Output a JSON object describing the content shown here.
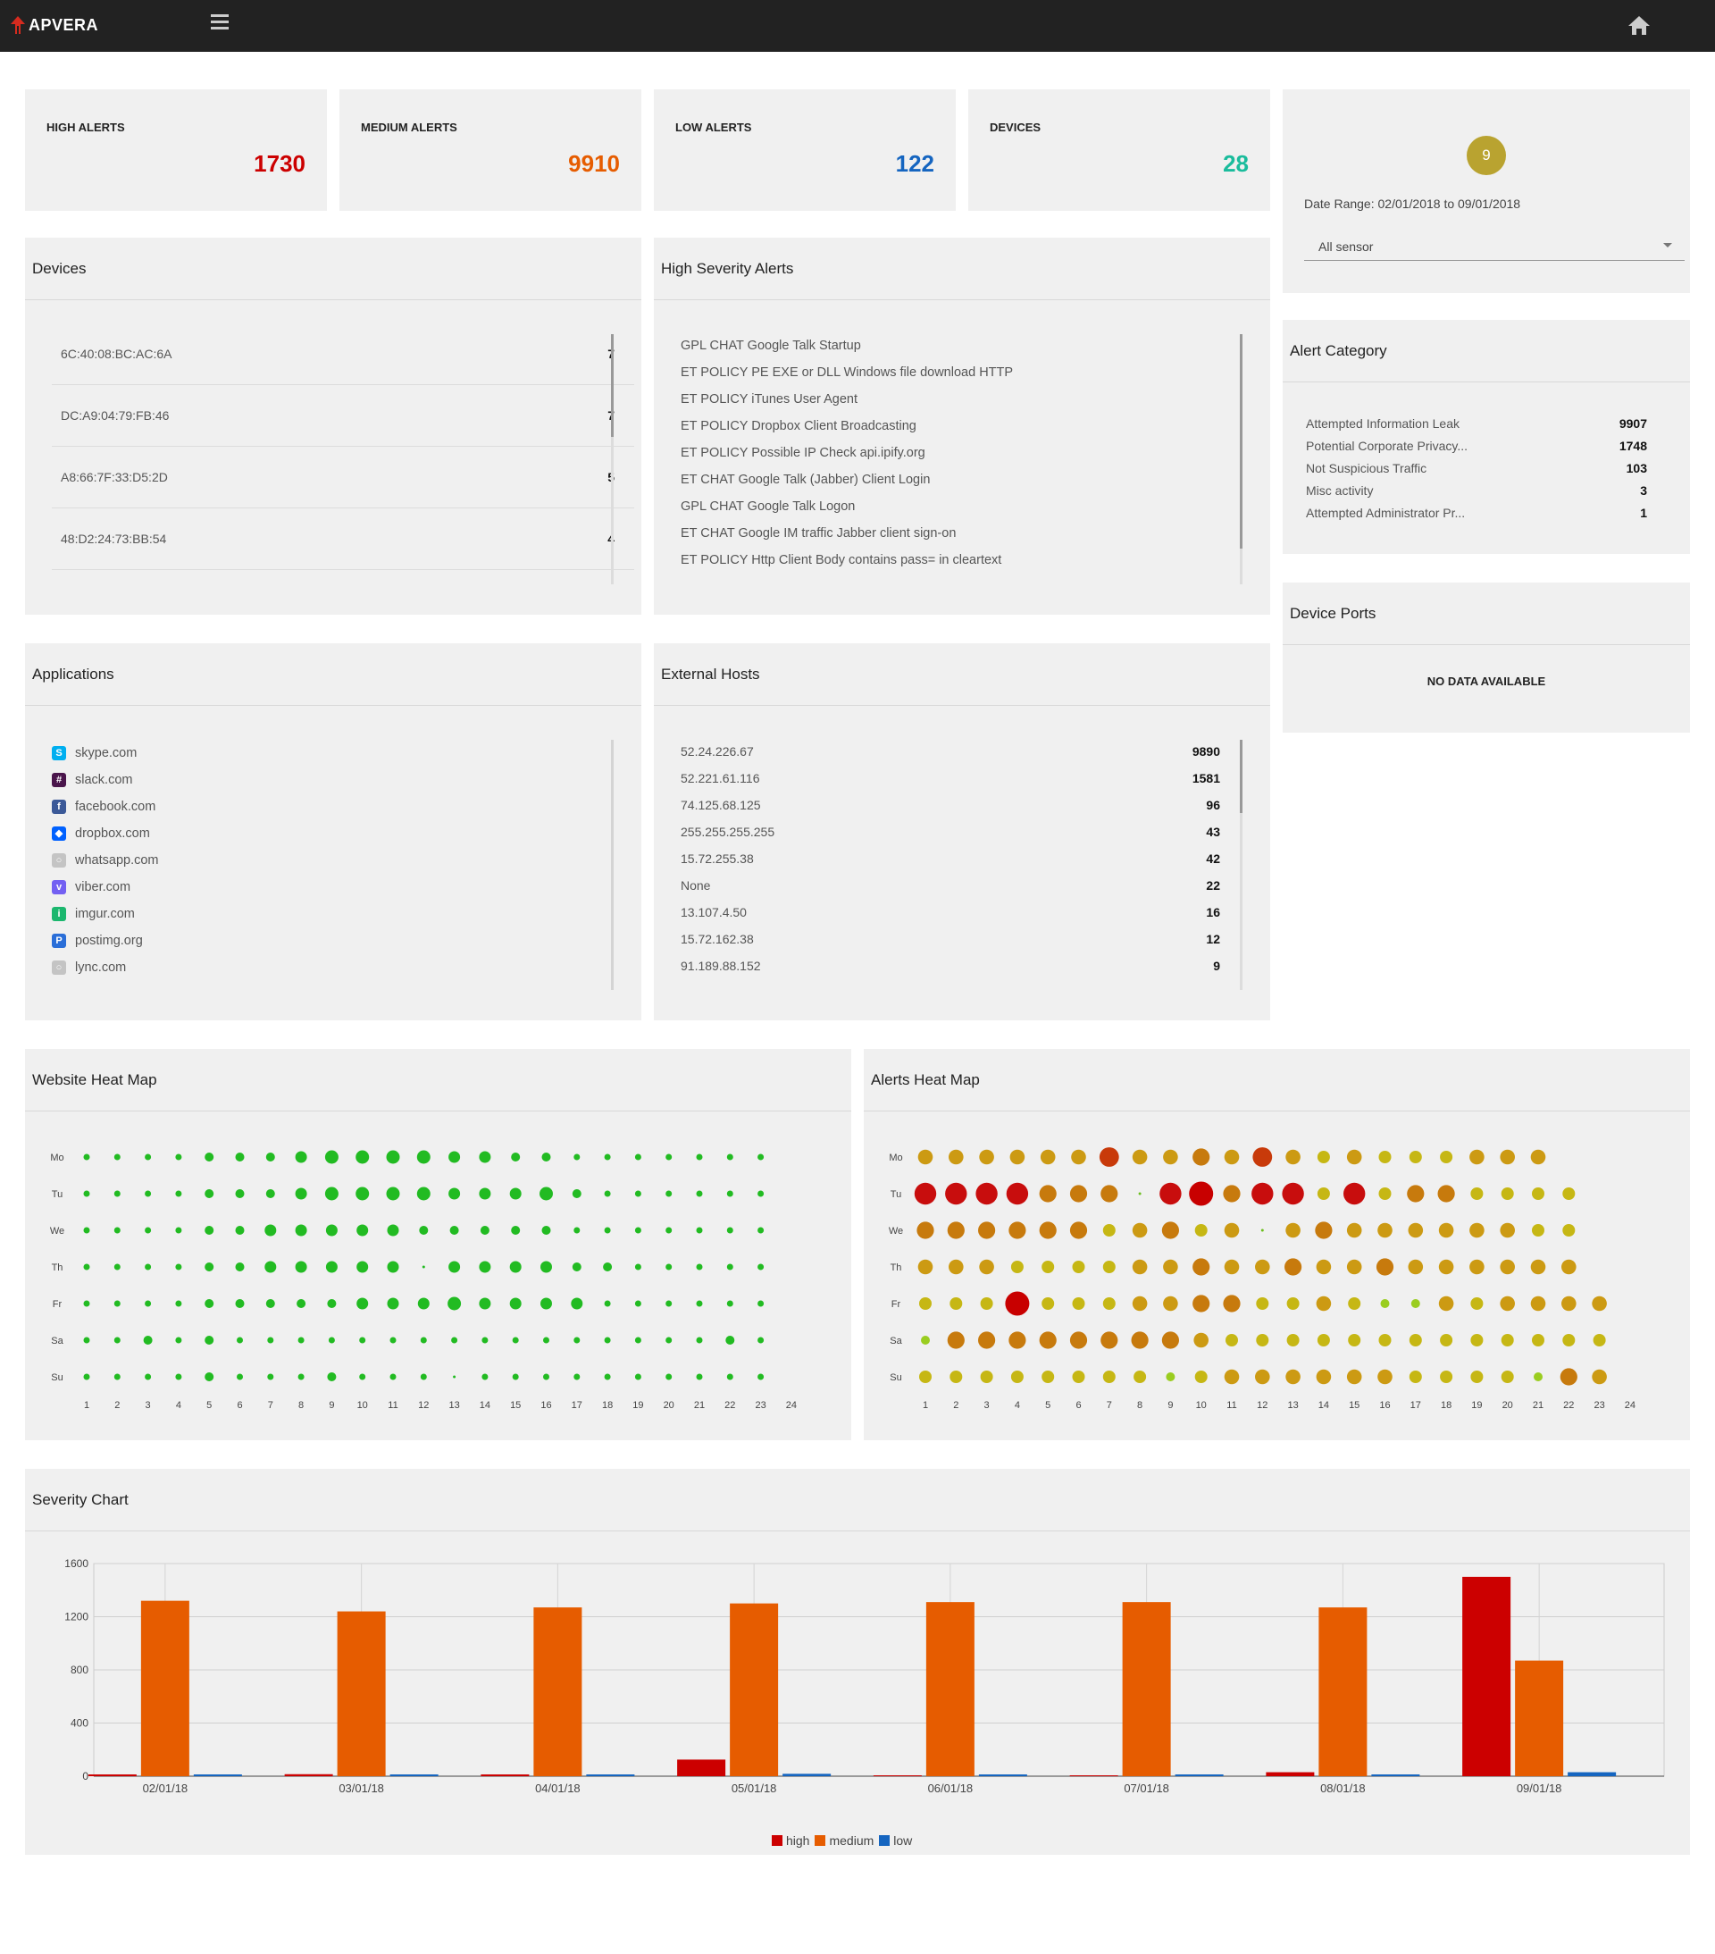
{
  "app": {
    "brand": "APVERA"
  },
  "kpis": [
    {
      "label": "HIGH ALERTS",
      "value": "1730",
      "color": "#cc0000"
    },
    {
      "label": "MEDIUM ALERTS",
      "value": "9910",
      "color": "#e65c00"
    },
    {
      "label": "LOW ALERTS",
      "value": "122",
      "color": "#1565c0"
    },
    {
      "label": "DEVICES",
      "value": "28",
      "color": "#1abc9c"
    }
  ],
  "filter": {
    "badge": "9",
    "date_range": "Date Range:  02/01/2018 to 09/01/2018",
    "sensor": "All sensor"
  },
  "devices": {
    "title": "Devices",
    "rows": [
      {
        "mac": "6C:40:08:BC:AC:6A",
        "count": "7"
      },
      {
        "mac": "DC:A9:04:79:FB:46",
        "count": "7"
      },
      {
        "mac": "A8:66:7F:33:D5:2D",
        "count": "5"
      },
      {
        "mac": "48:D2:24:73:BB:54",
        "count": "4"
      }
    ]
  },
  "high_severity": {
    "title": "High Severity Alerts",
    "items": [
      "GPL CHAT Google Talk Startup",
      "ET POLICY PE EXE or DLL Windows file download HTTP",
      "ET POLICY iTunes User Agent",
      "ET POLICY Dropbox Client Broadcasting",
      "ET POLICY Possible IP Check api.ipify.org",
      "ET CHAT Google Talk (Jabber) Client Login",
      "GPL CHAT Google Talk Logon",
      "ET CHAT Google IM traffic Jabber client sign-on",
      "ET POLICY Http Client Body contains pass= in cleartext"
    ]
  },
  "alert_category": {
    "title": "Alert Category",
    "rows": [
      {
        "name": "Attempted Information Leak",
        "count": "9907"
      },
      {
        "name": "Potential Corporate Privacy...",
        "count": "1748"
      },
      {
        "name": "Not Suspicious Traffic",
        "count": "103"
      },
      {
        "name": "Misc activity",
        "count": "3"
      },
      {
        "name": "Attempted Administrator Pr...",
        "count": "1"
      }
    ]
  },
  "device_ports": {
    "title": "Device Ports",
    "empty": "NO DATA AVAILABLE"
  },
  "applications": {
    "title": "Applications",
    "items": [
      {
        "name": "skype.com",
        "icon": "skype-icon",
        "color": "#00aff0",
        "glyph": "S"
      },
      {
        "name": "slack.com",
        "icon": "slack-icon",
        "color": "#4a154b",
        "glyph": "#"
      },
      {
        "name": "facebook.com",
        "icon": "facebook-icon",
        "color": "#3b5998",
        "glyph": "f"
      },
      {
        "name": "dropbox.com",
        "icon": "dropbox-icon",
        "color": "#0061ff",
        "glyph": "◆"
      },
      {
        "name": "whatsapp.com",
        "icon": "globe-icon",
        "color": "#c4c4c4",
        "glyph": "○"
      },
      {
        "name": "viber.com",
        "icon": "viber-icon",
        "color": "#7360f2",
        "glyph": "v"
      },
      {
        "name": "imgur.com",
        "icon": "imgur-icon",
        "color": "#1bb76e",
        "glyph": "i"
      },
      {
        "name": "postimg.org",
        "icon": "postimg-icon",
        "color": "#2a6ed8",
        "glyph": "P"
      },
      {
        "name": "lync.com",
        "icon": "globe-icon",
        "color": "#c4c4c4",
        "glyph": "○"
      }
    ]
  },
  "external_hosts": {
    "title": "External Hosts",
    "rows": [
      {
        "host": "52.24.226.67",
        "count": "9890"
      },
      {
        "host": "52.221.61.116",
        "count": "1581"
      },
      {
        "host": "74.125.68.125",
        "count": "96"
      },
      {
        "host": "255.255.255.255",
        "count": "43"
      },
      {
        "host": "15.72.255.38",
        "count": "42"
      },
      {
        "host": "None",
        "count": "22"
      },
      {
        "host": "13.107.4.50",
        "count": "16"
      },
      {
        "host": "15.72.162.38",
        "count": "12"
      },
      {
        "host": "91.189.88.152",
        "count": "9"
      }
    ]
  },
  "website_heatmap": {
    "title": "Website Heat Map",
    "days": [
      "Mo",
      "Tu",
      "We",
      "Th",
      "Fr",
      "Sa",
      "Su"
    ],
    "hours": [
      "1",
      "2",
      "3",
      "4",
      "5",
      "6",
      "7",
      "8",
      "9",
      "10",
      "11",
      "12",
      "13",
      "14",
      "15",
      "16",
      "17",
      "18",
      "19",
      "20",
      "21",
      "22",
      "23",
      "24"
    ],
    "color": "#22bb22",
    "values": [
      [
        2,
        2,
        2,
        2,
        3,
        3,
        3,
        4,
        5,
        5,
        5,
        5,
        4,
        4,
        3,
        3,
        2,
        2,
        2,
        2,
        2,
        2,
        2
      ],
      [
        2,
        2,
        2,
        2,
        3,
        3,
        3,
        4,
        5,
        5,
        5,
        5,
        4,
        4,
        4,
        5,
        3,
        2,
        2,
        2,
        2,
        2,
        2
      ],
      [
        2,
        2,
        2,
        2,
        3,
        3,
        4,
        4,
        4,
        4,
        4,
        3,
        3,
        3,
        3,
        3,
        2,
        2,
        2,
        2,
        2,
        2,
        2
      ],
      [
        2,
        2,
        2,
        2,
        3,
        3,
        4,
        4,
        4,
        4,
        4,
        1,
        4,
        4,
        4,
        4,
        3,
        3,
        2,
        2,
        2,
        2,
        2
      ],
      [
        2,
        2,
        2,
        2,
        3,
        3,
        3,
        3,
        3,
        4,
        4,
        4,
        5,
        4,
        4,
        4,
        4,
        2,
        2,
        2,
        2,
        2,
        2
      ],
      [
        2,
        2,
        3,
        2,
        3,
        2,
        2,
        2,
        2,
        2,
        2,
        2,
        2,
        2,
        2,
        2,
        2,
        2,
        2,
        2,
        2,
        3,
        2
      ],
      [
        2,
        2,
        2,
        2,
        3,
        2,
        2,
        2,
        3,
        2,
        2,
        2,
        1,
        2,
        2,
        2,
        2,
        2,
        2,
        2,
        2,
        2,
        2
      ]
    ]
  },
  "alerts_heatmap": {
    "title": "Alerts Heat Map",
    "days": [
      "Mo",
      "Tu",
      "We",
      "Th",
      "Fr",
      "Sa",
      "Su"
    ],
    "hours": [
      "1",
      "2",
      "3",
      "4",
      "5",
      "6",
      "7",
      "8",
      "9",
      "10",
      "11",
      "12",
      "13",
      "14",
      "15",
      "16",
      "17",
      "18",
      "19",
      "20",
      "21",
      "22",
      "23",
      "24"
    ],
    "values": [
      [
        4,
        4,
        4,
        4,
        4,
        4,
        6,
        4,
        4,
        5,
        4,
        6,
        4,
        3,
        4,
        3,
        3,
        3,
        4,
        4,
        4
      ],
      [
        7,
        7,
        7,
        7,
        5,
        5,
        5,
        1,
        7,
        8,
        5,
        7,
        7,
        3,
        7,
        3,
        5,
        5,
        3,
        3,
        3,
        3
      ],
      [
        5,
        5,
        5,
        5,
        5,
        5,
        3,
        4,
        5,
        3,
        4,
        1,
        4,
        5,
        4,
        4,
        4,
        4,
        4,
        4,
        3,
        3
      ],
      [
        4,
        4,
        4,
        3,
        3,
        3,
        3,
        4,
        4,
        5,
        4,
        4,
        5,
        4,
        4,
        5,
        4,
        4,
        4,
        4,
        4,
        4
      ],
      [
        3,
        3,
        3,
        8,
        3,
        3,
        3,
        4,
        4,
        5,
        5,
        3,
        3,
        4,
        3,
        2,
        2,
        4,
        3,
        4,
        4,
        4,
        4
      ],
      [
        2,
        5,
        5,
        5,
        5,
        5,
        5,
        5,
        5,
        4,
        3,
        3,
        3,
        3,
        3,
        3,
        3,
        3,
        3,
        3,
        3,
        3,
        3
      ],
      [
        3,
        3,
        3,
        3,
        3,
        3,
        3,
        3,
        2,
        3,
        4,
        4,
        4,
        4,
        4,
        4,
        3,
        3,
        3,
        3,
        2,
        5,
        4
      ]
    ]
  },
  "severity_chart": {
    "title": "Severity Chart",
    "legend": [
      "high",
      "medium",
      "low"
    ],
    "colors": {
      "high": "#cc0000",
      "medium": "#e65c00",
      "low": "#1565c0"
    }
  },
  "chart_data": {
    "type": "bar",
    "categories": [
      "02/01/18",
      "03/01/18",
      "04/01/18",
      "05/01/18",
      "06/01/18",
      "07/01/18",
      "08/01/18",
      "09/01/18"
    ],
    "series": [
      {
        "name": "high",
        "values": [
          12,
          15,
          12,
          125,
          0,
          0,
          30,
          1500
        ]
      },
      {
        "name": "medium",
        "values": [
          1320,
          1240,
          1270,
          1300,
          1310,
          1310,
          1270,
          870
        ]
      },
      {
        "name": "low",
        "values": [
          5,
          5,
          5,
          18,
          2,
          2,
          10,
          30
        ]
      }
    ],
    "yticks": [
      "0",
      "400",
      "800",
      "1200",
      "1600"
    ],
    "ylim": [
      0,
      1600
    ],
    "legend_position": "bottom",
    "grid": true
  }
}
